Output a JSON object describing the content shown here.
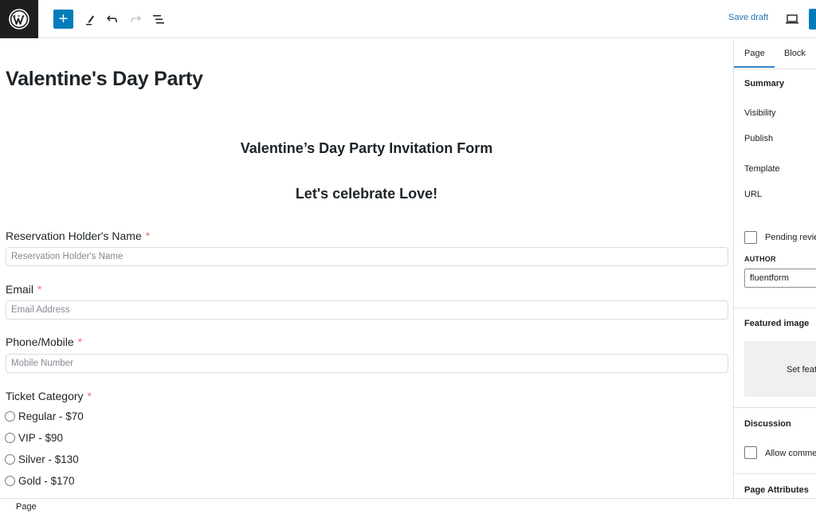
{
  "toolbar": {
    "logo_icon": "wordpress-logo-icon",
    "add_block_symbol": "+",
    "tools": [
      "pencil-icon",
      "undo-icon",
      "redo-icon",
      "list-view-icon"
    ],
    "save_draft_label": "Save draft",
    "preview_icon": "desktop-icon",
    "accent_color": "#007cba"
  },
  "editor": {
    "post_title": "Valentine's Day Party",
    "form_title": "Valentine’s Day Party Invitation Form",
    "form_subtitle": "Let's celebrate Love!",
    "fields": [
      {
        "label": "Reservation Holder's Name",
        "required_mark": "*",
        "placeholder": "Reservation Holder's Name"
      },
      {
        "label": "Email",
        "required_mark": "*",
        "placeholder": "Email Address"
      },
      {
        "label": "Phone/Mobile",
        "required_mark": "*",
        "placeholder": "Mobile Number"
      }
    ],
    "ticket": {
      "label": "Ticket Category",
      "required_mark": "*",
      "options": [
        "Regular - $70",
        "VIP - $90",
        "Silver - $130",
        "Gold - $170"
      ]
    }
  },
  "sidebar": {
    "tabs": [
      {
        "label": "Page",
        "active": true
      },
      {
        "label": "Block",
        "active": false
      }
    ],
    "summary_heading": "Summary",
    "rows": [
      "Visibility",
      "Publish",
      "Template",
      "URL"
    ],
    "pending_review_label": "Pending revie",
    "author_label": "AUTHOR",
    "author_value": "fluentform",
    "featured_image_heading": "Featured image",
    "featured_image_button": "Set feat",
    "discussion_heading": "Discussion",
    "allow_comments_label": "Allow commer",
    "page_attributes_heading": "Page Attributes"
  },
  "footer": {
    "breadcrumb": "Page"
  }
}
